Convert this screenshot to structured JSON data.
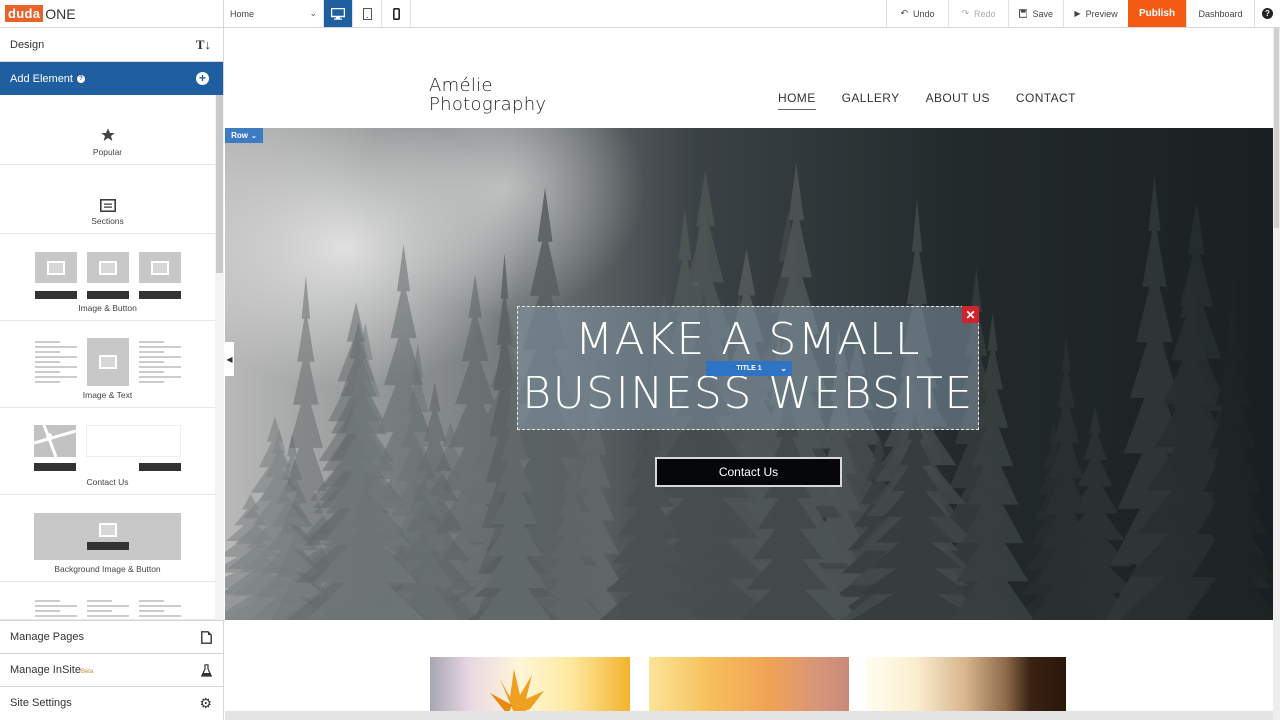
{
  "topbar": {
    "brand": {
      "duda": "duda",
      "one": "ONE"
    },
    "page_select": {
      "value": "Home",
      "chevron": "chevron-down-icon"
    },
    "device_buttons": [
      {
        "name": "desktop",
        "icon": "desktop-icon",
        "active": true
      },
      {
        "name": "tablet",
        "icon": "tablet-icon",
        "active": false
      },
      {
        "name": "mobile",
        "icon": "mobile-icon",
        "active": false
      }
    ],
    "undo_label": "Undo",
    "redo_label": "Redo",
    "save_label": "Save",
    "preview_label": "Preview",
    "publish_label": "Publish",
    "dashboard_label": "Dashboard",
    "help_icon": "question-icon",
    "publish_color": "#f35b13"
  },
  "sidebar": {
    "design_label": "Design",
    "design_icon_text": "T↓",
    "add_element_label": "Add Element",
    "add_element_help": "?",
    "add_element_color": "#1f5fa0",
    "elements": [
      {
        "label": "Popular",
        "icon": "star-icon"
      },
      {
        "label": "Sections",
        "icon": "sections-icon"
      },
      {
        "label": "Image & Button",
        "icon": "image-button-thumbnail"
      },
      {
        "label": "Image & Text",
        "icon": "image-text-thumbnail"
      },
      {
        "label": "Contact Us",
        "icon": "contact-thumbnail"
      },
      {
        "label": "Background Image & Button",
        "icon": "background-image-thumbnail"
      }
    ],
    "bottom": [
      {
        "label": "Manage Pages",
        "icon": "page-icon"
      },
      {
        "label": "Manage InSite",
        "badge": "Beta",
        "icon": "flask-icon"
      },
      {
        "label": "Site Settings",
        "icon": "gear-icon"
      }
    ]
  },
  "site": {
    "logo_line1": "Amélie",
    "logo_line2": "Photography",
    "nav": [
      {
        "label": "HOME",
        "active": true
      },
      {
        "label": "GALLERY",
        "active": false
      },
      {
        "label": "ABOUT US",
        "active": false
      },
      {
        "label": "CONTACT",
        "active": false
      }
    ],
    "row_tag": "Row",
    "hero_title_line1": "MAKE A SMALL",
    "hero_title_line2": "BUSINESS WEBSITE",
    "title_tag": "TITLE 1",
    "cta_label": "Contact Us"
  }
}
